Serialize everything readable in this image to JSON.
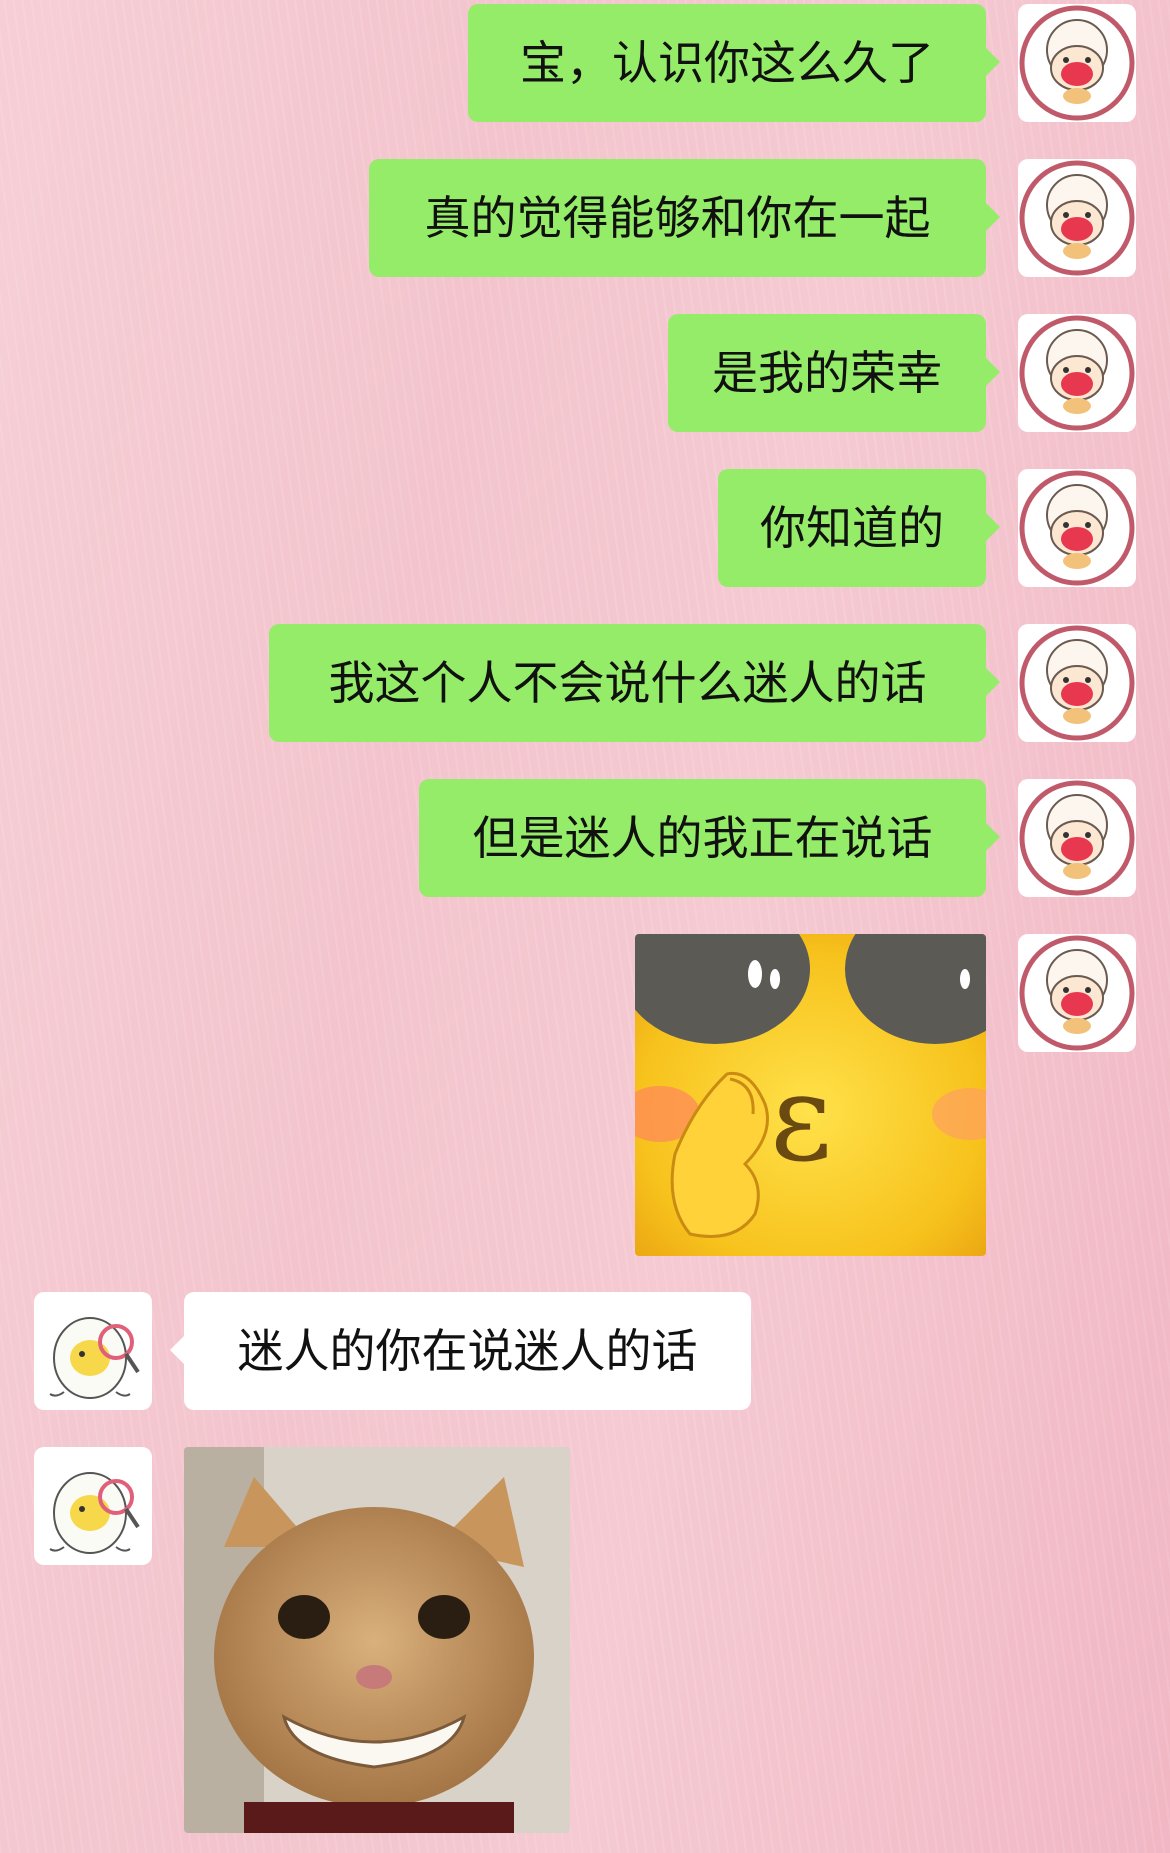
{
  "messages": [
    {
      "side": "out",
      "text": "宝，认识你这么久了"
    },
    {
      "side": "out",
      "text": "真的觉得能够和你在一起"
    },
    {
      "side": "out",
      "text": "是我的荣幸"
    },
    {
      "side": "out",
      "text": "你知道的"
    },
    {
      "side": "out",
      "text": "我这个人不会说什么迷人的话"
    },
    {
      "side": "out",
      "text": "但是迷人的我正在说话"
    },
    {
      "side": "out",
      "sticker": "blushing-duck-face-sticker",
      "text": "ε"
    },
    {
      "side": "in",
      "text": "迷人的你在说迷人的话"
    },
    {
      "side": "in",
      "sticker": "smiling-cat-sticker"
    }
  ],
  "avatars": {
    "self": "sheep-avatar-icon",
    "other": "egg-with-magnifier-avatar-icon"
  },
  "colors": {
    "out_bubble": "#95ec69",
    "in_bubble": "#ffffff",
    "background": "#f4c6cf"
  }
}
